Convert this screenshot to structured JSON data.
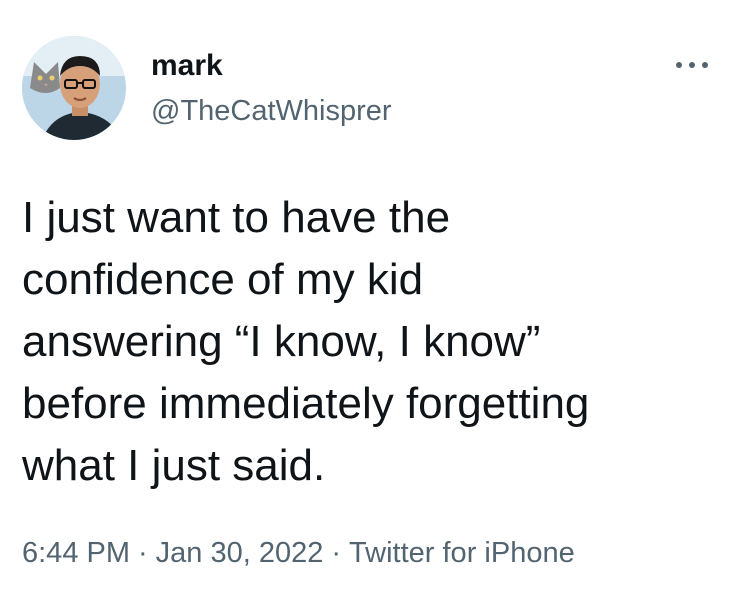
{
  "author": {
    "display_name": "mark",
    "handle": "@TheCatWhisprer",
    "avatar_icon": "profile-photo-with-cat"
  },
  "more_menu_icon": "ellipsis-icon",
  "tweet": {
    "lines": [
      "I just want to have the",
      "confidence of my kid",
      "answering “I know, I know”",
      "before immediately forgetting",
      "what I just said."
    ]
  },
  "meta": {
    "time": "6:44 PM",
    "separator": "·",
    "date": "Jan 30, 2022",
    "source": "Twitter for iPhone"
  },
  "colors": {
    "text_primary": "#0f1419",
    "text_secondary": "#536471",
    "background": "#ffffff"
  }
}
